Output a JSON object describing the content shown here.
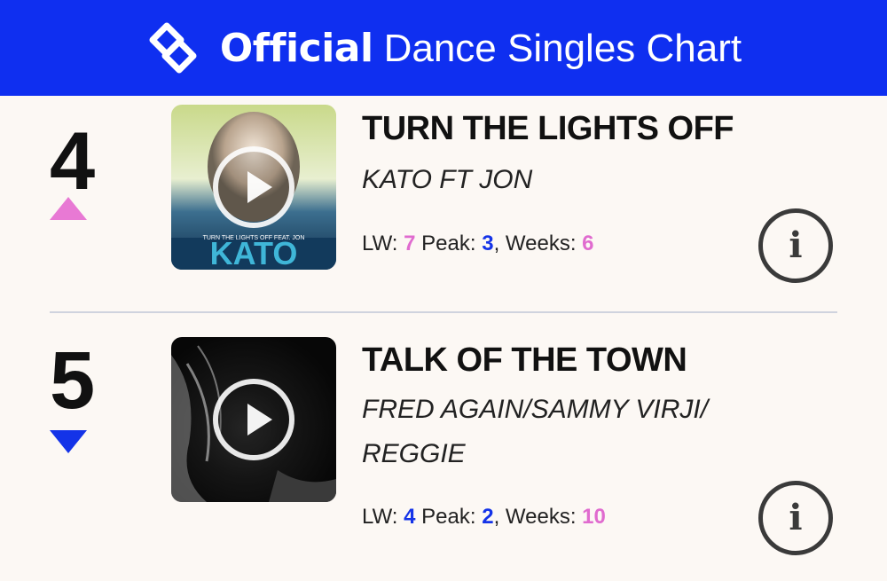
{
  "header": {
    "brand": "Official",
    "chart_name": "Dance Singles Chart",
    "logo_icon": "official-charts-logo",
    "background": "#0f2ff0"
  },
  "entries": [
    {
      "position": "4",
      "movement": "up",
      "movement_color": "#e879d4",
      "title": "TURN THE LIGHTS OFF",
      "artist_lines": [
        "KATO FT JON"
      ],
      "lw_label": "LW:",
      "lw": "7",
      "peak_label": "Peak:",
      "peak": "3",
      "weeks_label": ", Weeks:",
      "weeks": "6",
      "artwork_text": "KATO",
      "artwork_subtext": "TURN THE LIGHTS OFF FEAT. JON"
    },
    {
      "position": "5",
      "movement": "down",
      "movement_color": "#1433e8",
      "title": "TALK OF THE TOWN",
      "artist_lines": [
        "FRED AGAIN/SAMMY VIRJI/",
        "REGGIE"
      ],
      "lw_label": "LW:",
      "lw": "4",
      "peak_label": "Peak:",
      "peak": "2",
      "weeks_label": ", Weeks:",
      "weeks": "10"
    }
  ],
  "info_icon_glyph": "i",
  "accent_blue": "#1433e8",
  "accent_pink": "#e06bcf"
}
